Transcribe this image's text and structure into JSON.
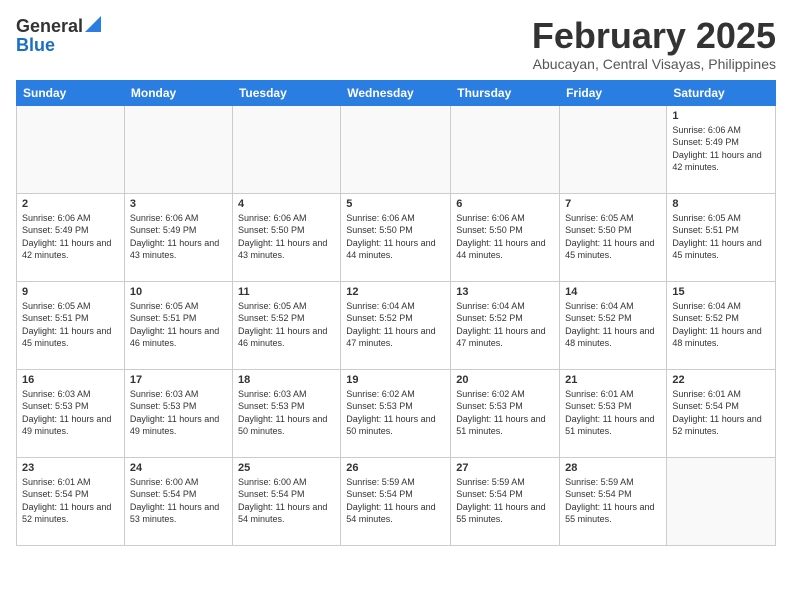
{
  "logo": {
    "general": "General",
    "blue": "Blue"
  },
  "header": {
    "month_year": "February 2025",
    "location": "Abucayan, Central Visayas, Philippines"
  },
  "weekdays": [
    "Sunday",
    "Monday",
    "Tuesday",
    "Wednesday",
    "Thursday",
    "Friday",
    "Saturday"
  ],
  "weeks": [
    [
      {
        "day": "",
        "info": ""
      },
      {
        "day": "",
        "info": ""
      },
      {
        "day": "",
        "info": ""
      },
      {
        "day": "",
        "info": ""
      },
      {
        "day": "",
        "info": ""
      },
      {
        "day": "",
        "info": ""
      },
      {
        "day": "1",
        "info": "Sunrise: 6:06 AM\nSunset: 5:49 PM\nDaylight: 11 hours and 42 minutes."
      }
    ],
    [
      {
        "day": "2",
        "info": "Sunrise: 6:06 AM\nSunset: 5:49 PM\nDaylight: 11 hours and 42 minutes."
      },
      {
        "day": "3",
        "info": "Sunrise: 6:06 AM\nSunset: 5:49 PM\nDaylight: 11 hours and 43 minutes."
      },
      {
        "day": "4",
        "info": "Sunrise: 6:06 AM\nSunset: 5:50 PM\nDaylight: 11 hours and 43 minutes."
      },
      {
        "day": "5",
        "info": "Sunrise: 6:06 AM\nSunset: 5:50 PM\nDaylight: 11 hours and 44 minutes."
      },
      {
        "day": "6",
        "info": "Sunrise: 6:06 AM\nSunset: 5:50 PM\nDaylight: 11 hours and 44 minutes."
      },
      {
        "day": "7",
        "info": "Sunrise: 6:05 AM\nSunset: 5:50 PM\nDaylight: 11 hours and 45 minutes."
      },
      {
        "day": "8",
        "info": "Sunrise: 6:05 AM\nSunset: 5:51 PM\nDaylight: 11 hours and 45 minutes."
      }
    ],
    [
      {
        "day": "9",
        "info": "Sunrise: 6:05 AM\nSunset: 5:51 PM\nDaylight: 11 hours and 45 minutes."
      },
      {
        "day": "10",
        "info": "Sunrise: 6:05 AM\nSunset: 5:51 PM\nDaylight: 11 hours and 46 minutes."
      },
      {
        "day": "11",
        "info": "Sunrise: 6:05 AM\nSunset: 5:52 PM\nDaylight: 11 hours and 46 minutes."
      },
      {
        "day": "12",
        "info": "Sunrise: 6:04 AM\nSunset: 5:52 PM\nDaylight: 11 hours and 47 minutes."
      },
      {
        "day": "13",
        "info": "Sunrise: 6:04 AM\nSunset: 5:52 PM\nDaylight: 11 hours and 47 minutes."
      },
      {
        "day": "14",
        "info": "Sunrise: 6:04 AM\nSunset: 5:52 PM\nDaylight: 11 hours and 48 minutes."
      },
      {
        "day": "15",
        "info": "Sunrise: 6:04 AM\nSunset: 5:52 PM\nDaylight: 11 hours and 48 minutes."
      }
    ],
    [
      {
        "day": "16",
        "info": "Sunrise: 6:03 AM\nSunset: 5:53 PM\nDaylight: 11 hours and 49 minutes."
      },
      {
        "day": "17",
        "info": "Sunrise: 6:03 AM\nSunset: 5:53 PM\nDaylight: 11 hours and 49 minutes."
      },
      {
        "day": "18",
        "info": "Sunrise: 6:03 AM\nSunset: 5:53 PM\nDaylight: 11 hours and 50 minutes."
      },
      {
        "day": "19",
        "info": "Sunrise: 6:02 AM\nSunset: 5:53 PM\nDaylight: 11 hours and 50 minutes."
      },
      {
        "day": "20",
        "info": "Sunrise: 6:02 AM\nSunset: 5:53 PM\nDaylight: 11 hours and 51 minutes."
      },
      {
        "day": "21",
        "info": "Sunrise: 6:01 AM\nSunset: 5:53 PM\nDaylight: 11 hours and 51 minutes."
      },
      {
        "day": "22",
        "info": "Sunrise: 6:01 AM\nSunset: 5:54 PM\nDaylight: 11 hours and 52 minutes."
      }
    ],
    [
      {
        "day": "23",
        "info": "Sunrise: 6:01 AM\nSunset: 5:54 PM\nDaylight: 11 hours and 52 minutes."
      },
      {
        "day": "24",
        "info": "Sunrise: 6:00 AM\nSunset: 5:54 PM\nDaylight: 11 hours and 53 minutes."
      },
      {
        "day": "25",
        "info": "Sunrise: 6:00 AM\nSunset: 5:54 PM\nDaylight: 11 hours and 54 minutes."
      },
      {
        "day": "26",
        "info": "Sunrise: 5:59 AM\nSunset: 5:54 PM\nDaylight: 11 hours and 54 minutes."
      },
      {
        "day": "27",
        "info": "Sunrise: 5:59 AM\nSunset: 5:54 PM\nDaylight: 11 hours and 55 minutes."
      },
      {
        "day": "28",
        "info": "Sunrise: 5:59 AM\nSunset: 5:54 PM\nDaylight: 11 hours and 55 minutes."
      },
      {
        "day": "",
        "info": ""
      }
    ]
  ]
}
